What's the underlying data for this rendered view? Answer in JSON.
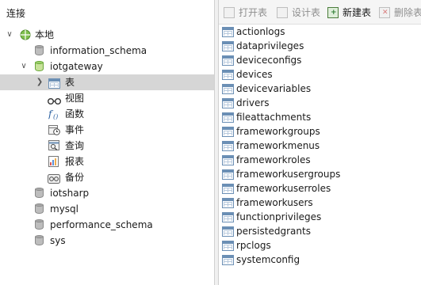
{
  "left_pane": {
    "header": "连接",
    "tree": {
      "connection": "本地",
      "databases": [
        "information_schema",
        "iotgateway",
        "iotsharp",
        "mysql",
        "performance_schema",
        "sys"
      ],
      "objects": [
        "表",
        "视图",
        "函数",
        "事件",
        "查询",
        "报表",
        "备份"
      ]
    }
  },
  "toolbar": {
    "open_table": "打开表",
    "design_table": "设计表",
    "new_table": "新建表",
    "delete_table": "删除表"
  },
  "tables": [
    "actionlogs",
    "dataprivileges",
    "deviceconfigs",
    "devices",
    "devicevariables",
    "drivers",
    "fileattachments",
    "frameworkgroups",
    "frameworkmenus",
    "frameworkroles",
    "frameworkusergroups",
    "frameworkuserroles",
    "frameworkusers",
    "functionprivileges",
    "persistedgrants",
    "rpclogs",
    "systemconfig"
  ]
}
